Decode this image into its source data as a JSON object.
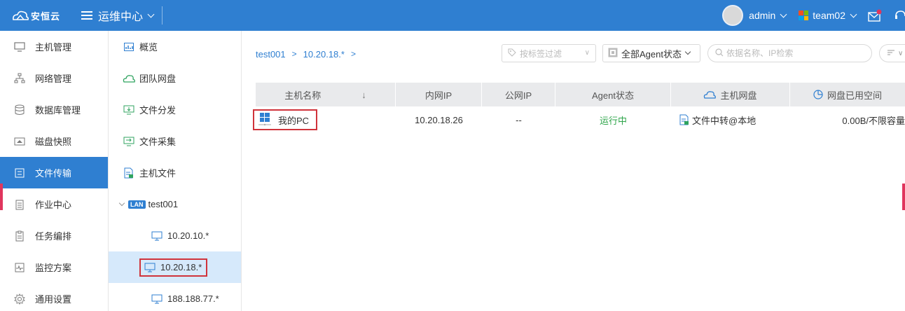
{
  "topbar": {
    "logo_text": "安恒云",
    "center_title": "运维中心",
    "user": "admin",
    "team": "team02",
    "colors": {
      "bar": "#2f7fd1"
    }
  },
  "sidebar": {
    "items": [
      {
        "label": "主机管理",
        "icon": "monitor-icon"
      },
      {
        "label": "网络管理",
        "icon": "network-icon"
      },
      {
        "label": "数据库管理",
        "icon": "database-icon"
      },
      {
        "label": "磁盘快照",
        "icon": "disk-snapshot-icon"
      },
      {
        "label": "文件传输",
        "icon": "file-transfer-icon",
        "active": true
      },
      {
        "label": "作业中心",
        "icon": "job-icon"
      },
      {
        "label": "任务编排",
        "icon": "task-orchestration-icon"
      },
      {
        "label": "监控方案",
        "icon": "monitor-plan-icon"
      },
      {
        "label": "通用设置",
        "icon": "gear-icon"
      }
    ]
  },
  "tree": {
    "items": [
      {
        "label": "概览",
        "icon": "overview-icon"
      },
      {
        "label": "团队网盘",
        "icon": "cloud-icon"
      },
      {
        "label": "文件分发",
        "icon": "file-distribute-icon"
      },
      {
        "label": "文件采集",
        "icon": "file-collect-icon"
      },
      {
        "label": "主机文件",
        "icon": "host-file-icon"
      }
    ],
    "lan_badge": "LAN",
    "lan_label": "test001",
    "subnets": [
      "10.20.10.*",
      "10.20.18.*",
      "188.188.77.*"
    ]
  },
  "breadcrumb": {
    "root": "test001",
    "current": "10.20.18.*"
  },
  "filters": {
    "tag_placeholder": "按标签过滤",
    "agent_status": "全部Agent状态",
    "search_placeholder": "依据名称、IP检索"
  },
  "table": {
    "headers": [
      "主机名称",
      "内网IP",
      "公网IP",
      "Agent状态",
      "主机网盘",
      "网盘已用空间"
    ],
    "rows": [
      {
        "name": "我的PC",
        "private_ip": "10.20.18.26",
        "public_ip": "--",
        "agent_status": "运行中",
        "disk": "文件中转@本地",
        "used": "0.00B/不限容量"
      }
    ]
  }
}
